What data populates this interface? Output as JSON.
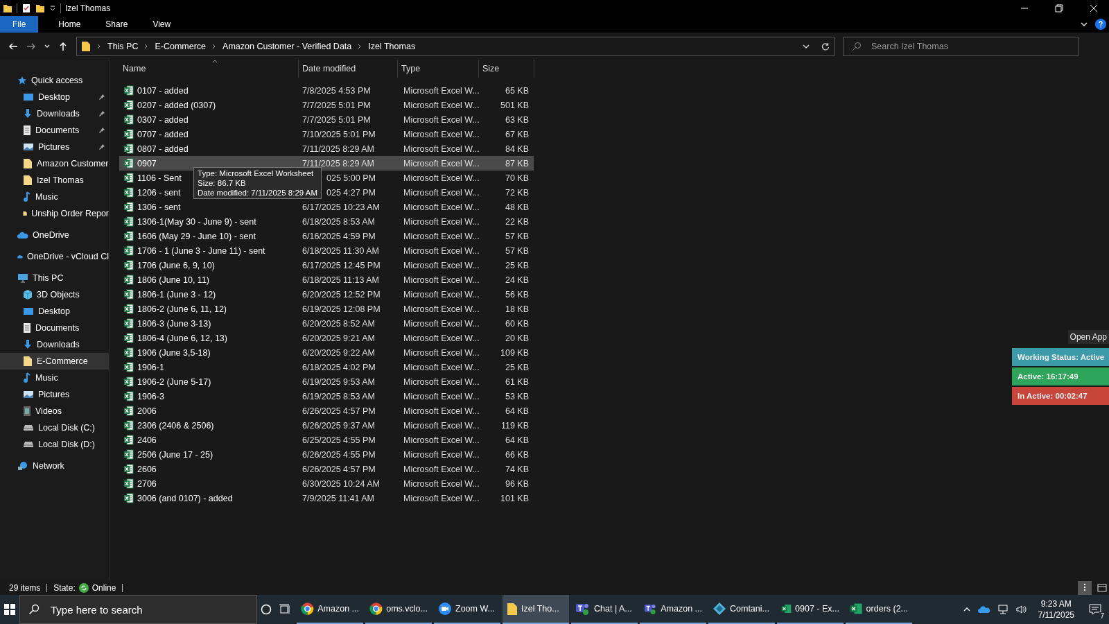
{
  "window": {
    "title": "Izel Thomas"
  },
  "ribbon_tabs": [
    {
      "label": "File",
      "selected": true
    },
    {
      "label": "Home",
      "selected": false
    },
    {
      "label": "Share",
      "selected": false
    },
    {
      "label": "View",
      "selected": false
    }
  ],
  "breadcrumbs": [
    "This PC",
    "E-Commerce",
    "Amazon Customer - Verified Data",
    "Izel Thomas"
  ],
  "search": {
    "placeholder": "Search Izel Thomas"
  },
  "sidebar": [
    {
      "label": "Quick access",
      "kind": "star",
      "selected": false,
      "children": [
        {
          "label": "Desktop",
          "kind": "desktop",
          "pinned": true,
          "selected": false
        },
        {
          "label": "Downloads",
          "kind": "download",
          "pinned": true,
          "selected": false
        },
        {
          "label": "Documents",
          "kind": "document",
          "pinned": true,
          "selected": false
        },
        {
          "label": "Pictures",
          "kind": "picture",
          "pinned": true,
          "selected": false
        },
        {
          "label": "Amazon Customer",
          "kind": "folder",
          "pinned": false,
          "selected": false
        },
        {
          "label": "Izel Thomas",
          "kind": "folder",
          "pinned": false,
          "selected": false
        },
        {
          "label": "Music",
          "kind": "music",
          "pinned": false,
          "selected": false
        },
        {
          "label": "Unship Order Repor",
          "kind": "folder",
          "pinned": false,
          "selected": false
        }
      ]
    },
    {
      "label": "OneDrive",
      "kind": "cloud",
      "selected": false
    },
    {
      "label": "OneDrive - vCloud Cl",
      "kind": "cloud",
      "selected": false
    },
    {
      "label": "This PC",
      "kind": "pc",
      "selected": false,
      "children": [
        {
          "label": "3D Objects",
          "kind": "cube",
          "pinned": false,
          "selected": false
        },
        {
          "label": "Desktop",
          "kind": "desktop",
          "pinned": false,
          "selected": false
        },
        {
          "label": "Documents",
          "kind": "document",
          "pinned": false,
          "selected": false
        },
        {
          "label": "Downloads",
          "kind": "download",
          "pinned": false,
          "selected": false
        },
        {
          "label": "E-Commerce",
          "kind": "folder",
          "pinned": false,
          "selected": true
        },
        {
          "label": "Music",
          "kind": "music",
          "pinned": false,
          "selected": false
        },
        {
          "label": "Pictures",
          "kind": "picture",
          "pinned": false,
          "selected": false
        },
        {
          "label": "Videos",
          "kind": "video",
          "pinned": false,
          "selected": false
        },
        {
          "label": "Local Disk (C:)",
          "kind": "disk",
          "pinned": false,
          "selected": false
        },
        {
          "label": "Local Disk (D:)",
          "kind": "disk",
          "pinned": false,
          "selected": false
        }
      ]
    },
    {
      "label": "Network",
      "kind": "network",
      "selected": false
    }
  ],
  "table": {
    "columns": [
      "Name",
      "Date modified",
      "Type",
      "Size"
    ],
    "rows": [
      {
        "name": "0107 - added",
        "date": "7/8/2025 4:53 PM",
        "type": "Microsoft Excel W...",
        "size": "65 KB",
        "hovered": false
      },
      {
        "name": "0207 - added (0307)",
        "date": "7/7/2025 5:01 PM",
        "type": "Microsoft Excel W...",
        "size": "501 KB",
        "hovered": false
      },
      {
        "name": "0307 - added",
        "date": "7/7/2025 5:01 PM",
        "type": "Microsoft Excel W...",
        "size": "63 KB",
        "hovered": false
      },
      {
        "name": "0707 - added",
        "date": "7/10/2025 5:01 PM",
        "type": "Microsoft Excel W...",
        "size": "67 KB",
        "hovered": false
      },
      {
        "name": "0807 - added",
        "date": "7/11/2025 8:29 AM",
        "type": "Microsoft Excel W...",
        "size": "84 KB",
        "hovered": false
      },
      {
        "name": "0907",
        "date": "7/11/2025 8:29 AM",
        "type": "Microsoft Excel W...",
        "size": "87 KB",
        "hovered": true
      },
      {
        "name": "1106 - Sent",
        "date": "025 5:00 PM",
        "type": "Microsoft Excel W...",
        "size": "70 KB",
        "hovered": false
      },
      {
        "name": "1206 - sent",
        "date": "025 4:27 PM",
        "type": "Microsoft Excel W...",
        "size": "72 KB",
        "hovered": false
      },
      {
        "name": "1306 - sent",
        "date": "6/17/2025 10:23 AM",
        "type": "Microsoft Excel W...",
        "size": "48 KB",
        "hovered": false
      },
      {
        "name": "1306-1(May 30 - June 9) - sent",
        "date": "6/18/2025 8:53 AM",
        "type": "Microsoft Excel W...",
        "size": "22 KB",
        "hovered": false
      },
      {
        "name": "1606 (May 29 - June 10) - sent",
        "date": "6/16/2025 4:59 PM",
        "type": "Microsoft Excel W...",
        "size": "57 KB",
        "hovered": false
      },
      {
        "name": "1706 - 1 (June 3 - June 11) - sent",
        "date": "6/18/2025 11:30 AM",
        "type": "Microsoft Excel W...",
        "size": "57 KB",
        "hovered": false
      },
      {
        "name": "1706 (June 6, 9, 10)",
        "date": "6/17/2025 12:45 PM",
        "type": "Microsoft Excel W...",
        "size": "25 KB",
        "hovered": false
      },
      {
        "name": "1806 (June 10, 11)",
        "date": "6/18/2025 11:13 AM",
        "type": "Microsoft Excel W...",
        "size": "24 KB",
        "hovered": false
      },
      {
        "name": "1806-1 (June 3 - 12)",
        "date": "6/20/2025 12:52 PM",
        "type": "Microsoft Excel W...",
        "size": "56 KB",
        "hovered": false
      },
      {
        "name": "1806-2 (June 6, 11, 12)",
        "date": "6/19/2025 12:08 PM",
        "type": "Microsoft Excel W...",
        "size": "18 KB",
        "hovered": false
      },
      {
        "name": "1806-3 (June 3-13)",
        "date": "6/20/2025 8:52 AM",
        "type": "Microsoft Excel W...",
        "size": "60 KB",
        "hovered": false
      },
      {
        "name": "1806-4 (June 6, 12, 13)",
        "date": "6/20/2025 9:21 AM",
        "type": "Microsoft Excel W...",
        "size": "20 KB",
        "hovered": false
      },
      {
        "name": "1906 (June 3,5-18)",
        "date": "6/20/2025 9:22 AM",
        "type": "Microsoft Excel W...",
        "size": "109 KB",
        "hovered": false
      },
      {
        "name": "1906-1",
        "date": "6/18/2025 4:02 PM",
        "type": "Microsoft Excel W...",
        "size": "25 KB",
        "hovered": false
      },
      {
        "name": "1906-2 (June 5-17)",
        "date": "6/19/2025 9:53 AM",
        "type": "Microsoft Excel W...",
        "size": "61 KB",
        "hovered": false
      },
      {
        "name": "1906-3",
        "date": "6/19/2025 8:53 AM",
        "type": "Microsoft Excel W...",
        "size": "53 KB",
        "hovered": false
      },
      {
        "name": "2006",
        "date": "6/26/2025 4:57 PM",
        "type": "Microsoft Excel W...",
        "size": "64 KB",
        "hovered": false
      },
      {
        "name": "2306 (2406 & 2506)",
        "date": "6/26/2025 9:37 AM",
        "type": "Microsoft Excel W...",
        "size": "119 KB",
        "hovered": false
      },
      {
        "name": "2406",
        "date": "6/25/2025 4:55 PM",
        "type": "Microsoft Excel W...",
        "size": "64 KB",
        "hovered": false
      },
      {
        "name": "2506 (June 17 - 25)",
        "date": "6/26/2025 4:55 PM",
        "type": "Microsoft Excel W...",
        "size": "66 KB",
        "hovered": false
      },
      {
        "name": "2606",
        "date": "6/26/2025 4:57 PM",
        "type": "Microsoft Excel W...",
        "size": "74 KB",
        "hovered": false
      },
      {
        "name": "2706",
        "date": "6/30/2025 10:24 AM",
        "type": "Microsoft Excel W...",
        "size": "96 KB",
        "hovered": false
      },
      {
        "name": "3006 (and 0107) - added",
        "date": "7/9/2025 11:41 AM",
        "type": "Microsoft Excel W...",
        "size": "101 KB",
        "hovered": false
      }
    ]
  },
  "tooltip": [
    "Type: Microsoft Excel Worksheet",
    "Size: 86.7 KB",
    "Date modified: 7/11/2025 8:29 AM"
  ],
  "status_bar": {
    "count": "29 items",
    "state_label": "State:",
    "state": "Online"
  },
  "tracker": {
    "open_button": "Open App",
    "bars": [
      {
        "label": "Working Status: Active",
        "color": "#3d9aa8"
      },
      {
        "label": "Active: 16:17:49",
        "color": "#2ea55a"
      },
      {
        "label": "In Active: 00:02:47",
        "color": "#c7453b"
      }
    ]
  },
  "taskbar": {
    "search_placeholder": "Type here to search",
    "apps": [
      {
        "label": "Amazon ...",
        "kind": "chrome",
        "selected": false
      },
      {
        "label": "oms.vclo...",
        "kind": "chrome",
        "selected": false
      },
      {
        "label": "Zoom W...",
        "kind": "zoom",
        "selected": false
      },
      {
        "label": "Izel Tho...",
        "kind": "folder",
        "selected": true
      },
      {
        "label": "Chat | A...",
        "kind": "teams",
        "selected": false
      },
      {
        "label": "Amazon ...",
        "kind": "teams",
        "selected": false
      },
      {
        "label": "Comtani...",
        "kind": "diamond",
        "selected": false
      },
      {
        "label": "0907 - Ex...",
        "kind": "excel",
        "selected": false
      },
      {
        "label": "orders (2...",
        "kind": "excel",
        "selected": false
      }
    ],
    "time": "9:23 AM",
    "date": "7/11/2025",
    "notifications": "7"
  }
}
